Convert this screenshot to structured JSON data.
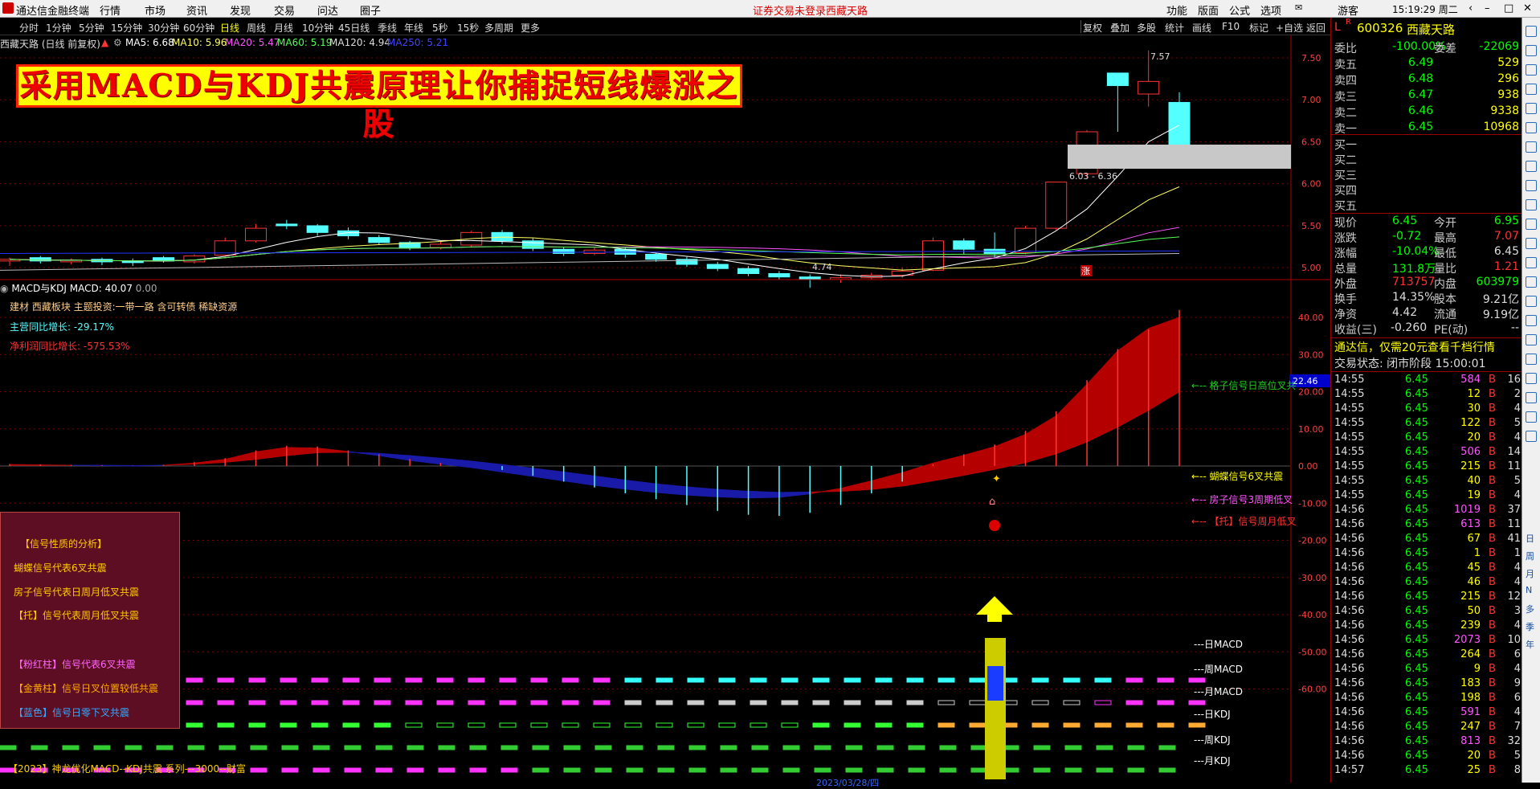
{
  "app": {
    "title": "通达信金融终端",
    "login_notice": "证券交易未登录",
    "stock_name_top": "西藏天路",
    "guest": "游客",
    "clock": "15:19:29 周二"
  },
  "menu": [
    "行情",
    "市场",
    "资讯",
    "发现",
    "交易",
    "问达",
    "圈子"
  ],
  "top_right_menu": [
    "功能",
    "版面",
    "公式",
    "选项"
  ],
  "periods": [
    "分时",
    "1分钟",
    "5分钟",
    "15分钟",
    "30分钟",
    "60分钟",
    "日线",
    "周线",
    "月线",
    "10分钟",
    "45日线",
    "季线",
    "年线",
    "5秒",
    "15秒",
    "多周期",
    "更多"
  ],
  "active_period": "日线",
  "toolbar_right": [
    "复权",
    "叠加",
    "多股",
    "统计",
    "画线",
    "F10",
    "标记",
    "+自选",
    "返回"
  ],
  "chart_info": {
    "name": "西藏天路 (日线 前复权)",
    "ma5": "MA5: 6.68",
    "ma10": "MA10: 5.96",
    "ma20": "MA20: 5.47",
    "ma60": "MA60: 5.19",
    "ma120": "MA120: 4.94",
    "ma250": "MA250: 5.21"
  },
  "banner": "采用MACD与KDJ共震原理让你捕捉短线爆涨之股",
  "price_axis": [
    "7.50",
    "7.00",
    "6.50",
    "6.00",
    "5.50",
    "5.00"
  ],
  "annotations": {
    "high": "7.57",
    "low": "4.74",
    "zone": "6.03 - 6.36",
    "rise": "涨"
  },
  "indicator": {
    "title": "MACD与KDJ",
    "macd": "MACD: 40.07",
    "zero": "0.00",
    "sector": "建材 西藏板块 主题投资:一带一路 含可转债 稀缺资源",
    "rev_growth": "主营同比增长: -29.17%",
    "profit_growth": "净利润同比增长: -575.53%",
    "current_value": "22.46"
  },
  "macd_axis": [
    "40.00",
    "30.00",
    "20.00",
    "10.00",
    "0.00",
    "-10.00",
    "-20.00",
    "-30.00",
    "-40.00",
    "-50.00",
    "-60.00"
  ],
  "signal_labels": [
    "←-- 格子信号日高位叉共",
    "←-- 蝴蝶信号6叉共震",
    "←-- 房子信号3周期低叉",
    "←-- 【托】信号周月低叉"
  ],
  "row_labels": [
    "---日MACD",
    "---周MACD",
    "---月MACD",
    "---日KDJ",
    "---周KDJ",
    "---月KDJ"
  ],
  "legend": {
    "title": "【信号性质的分析】",
    "l1": "蝴蝶信号代表6叉共震",
    "l2": "房子信号代表日周月低叉共震",
    "l3": "【托】信号代表周月低叉共震",
    "l4": "【粉红柱】信号代表6叉共震",
    "l5": "【金黄柱】信号日叉位置较低共震",
    "l6": "【蓝色】信号日零下叉共震"
  },
  "bottom_text": "【2023】神龙优化MACD--KDJ共震 系列---3000--财富",
  "bottom_date": "2023/03/28/四",
  "quote": {
    "code": "600326",
    "name": "西藏天路",
    "weibi": "委比",
    "weibi_val": "-100.00%",
    "weicha": "委差",
    "weicha_val": "-22069",
    "asks": [
      {
        "label": "卖五",
        "price": "6.49",
        "vol": "529"
      },
      {
        "label": "卖四",
        "price": "6.48",
        "vol": "296"
      },
      {
        "label": "卖三",
        "price": "6.47",
        "vol": "938"
      },
      {
        "label": "卖二",
        "price": "6.46",
        "vol": "9338"
      },
      {
        "label": "卖一",
        "price": "6.45",
        "vol": "10968"
      }
    ],
    "bids": [
      "买一",
      "买二",
      "买三",
      "买四",
      "买五"
    ],
    "stats": [
      {
        "a": "现价",
        "av": "6.45",
        "b": "今开",
        "bv": "6.95"
      },
      {
        "a": "涨跌",
        "av": "-0.72",
        "b": "最高",
        "bv": "7.07"
      },
      {
        "a": "涨幅",
        "av": "-10.04%",
        "b": "最低",
        "bv": "6.45"
      },
      {
        "a": "总量",
        "av": "131.8万",
        "b": "量比",
        "bv": "1.21"
      },
      {
        "a": "外盘",
        "av": "713757",
        "b": "内盘",
        "bv": "603979"
      },
      {
        "a": "换手",
        "av": "14.35%",
        "b": "股本",
        "bv": "9.21亿"
      },
      {
        "a": "净资",
        "av": "4.42",
        "b": "流通",
        "bv": "9.19亿"
      },
      {
        "a": "收益(三)",
        "av": "-0.260",
        "b": "PE(动)",
        "bv": "--"
      }
    ],
    "ad": "通达信，仅需20元查看千档行情",
    "trade_state": "交易状态: 闭市阶段 15:00:01"
  },
  "ticks": [
    {
      "t": "14:55",
      "p": "6.45",
      "v": "584",
      "s": "B",
      "n": "16"
    },
    {
      "t": "14:55",
      "p": "6.45",
      "v": "12",
      "s": "B",
      "n": "2"
    },
    {
      "t": "14:55",
      "p": "6.45",
      "v": "30",
      "s": "B",
      "n": "4"
    },
    {
      "t": "14:55",
      "p": "6.45",
      "v": "122",
      "s": "B",
      "n": "5"
    },
    {
      "t": "14:55",
      "p": "6.45",
      "v": "20",
      "s": "B",
      "n": "4"
    },
    {
      "t": "14:55",
      "p": "6.45",
      "v": "506",
      "s": "B",
      "n": "14"
    },
    {
      "t": "14:55",
      "p": "6.45",
      "v": "215",
      "s": "B",
      "n": "11"
    },
    {
      "t": "14:55",
      "p": "6.45",
      "v": "40",
      "s": "B",
      "n": "5"
    },
    {
      "t": "14:55",
      "p": "6.45",
      "v": "19",
      "s": "B",
      "n": "4"
    },
    {
      "t": "14:56",
      "p": "6.45",
      "v": "1019",
      "s": "B",
      "n": "37"
    },
    {
      "t": "14:56",
      "p": "6.45",
      "v": "613",
      "s": "B",
      "n": "11"
    },
    {
      "t": "14:56",
      "p": "6.45",
      "v": "67",
      "s": "B",
      "n": "41"
    },
    {
      "t": "14:56",
      "p": "6.45",
      "v": "1",
      "s": "B",
      "n": "1"
    },
    {
      "t": "14:56",
      "p": "6.45",
      "v": "45",
      "s": "B",
      "n": "4"
    },
    {
      "t": "14:56",
      "p": "6.45",
      "v": "46",
      "s": "B",
      "n": "4"
    },
    {
      "t": "14:56",
      "p": "6.45",
      "v": "215",
      "s": "B",
      "n": "12"
    },
    {
      "t": "14:56",
      "p": "6.45",
      "v": "50",
      "s": "B",
      "n": "3"
    },
    {
      "t": "14:56",
      "p": "6.45",
      "v": "239",
      "s": "B",
      "n": "4"
    },
    {
      "t": "14:56",
      "p": "6.45",
      "v": "2073",
      "s": "B",
      "n": "10"
    },
    {
      "t": "14:56",
      "p": "6.45",
      "v": "264",
      "s": "B",
      "n": "6"
    },
    {
      "t": "14:56",
      "p": "6.45",
      "v": "9",
      "s": "B",
      "n": "4"
    },
    {
      "t": "14:56",
      "p": "6.45",
      "v": "183",
      "s": "B",
      "n": "9"
    },
    {
      "t": "14:56",
      "p": "6.45",
      "v": "198",
      "s": "B",
      "n": "6"
    },
    {
      "t": "14:56",
      "p": "6.45",
      "v": "591",
      "s": "B",
      "n": "4"
    },
    {
      "t": "14:56",
      "p": "6.45",
      "v": "247",
      "s": "B",
      "n": "7"
    },
    {
      "t": "14:56",
      "p": "6.45",
      "v": "813",
      "s": "B",
      "n": "32"
    },
    {
      "t": "14:56",
      "p": "6.45",
      "v": "20",
      "s": "B",
      "n": "5"
    },
    {
      "t": "14:57",
      "p": "6.45",
      "v": "25",
      "s": "B",
      "n": "8"
    }
  ],
  "side_tools": [
    "日",
    "周",
    "月",
    "N",
    "多",
    "季",
    "年"
  ],
  "candles": [
    {
      "o": 5.06,
      "c": 5.08,
      "h": 5.1,
      "l": 5.0
    },
    {
      "o": 5.1,
      "c": 5.06,
      "h": 5.12,
      "l": 5.03
    },
    {
      "o": 5.05,
      "c": 5.07,
      "h": 5.09,
      "l": 5.02
    },
    {
      "o": 5.08,
      "c": 5.05,
      "h": 5.1,
      "l": 5.01
    },
    {
      "o": 5.06,
      "c": 5.05,
      "h": 5.09,
      "l": 5.0
    },
    {
      "o": 5.1,
      "c": 5.06,
      "h": 5.12,
      "l": 5.04
    },
    {
      "o": 5.05,
      "c": 5.12,
      "h": 5.14,
      "l": 5.03
    },
    {
      "o": 5.13,
      "c": 5.3,
      "h": 5.34,
      "l": 5.12
    },
    {
      "o": 5.3,
      "c": 5.45,
      "h": 5.5,
      "l": 5.28
    },
    {
      "o": 5.5,
      "c": 5.48,
      "h": 5.55,
      "l": 5.44
    },
    {
      "o": 5.48,
      "c": 5.4,
      "h": 5.5,
      "l": 5.36
    },
    {
      "o": 5.42,
      "c": 5.36,
      "h": 5.46,
      "l": 5.32
    },
    {
      "o": 5.34,
      "c": 5.28,
      "h": 5.37,
      "l": 5.25
    },
    {
      "o": 5.28,
      "c": 5.22,
      "h": 5.3,
      "l": 5.19
    },
    {
      "o": 5.22,
      "c": 5.26,
      "h": 5.3,
      "l": 5.2
    },
    {
      "o": 5.25,
      "c": 5.4,
      "h": 5.42,
      "l": 5.22
    },
    {
      "o": 5.4,
      "c": 5.3,
      "h": 5.43,
      "l": 5.26
    },
    {
      "o": 5.3,
      "c": 5.21,
      "h": 5.33,
      "l": 5.18
    },
    {
      "o": 5.2,
      "c": 5.15,
      "h": 5.23,
      "l": 5.12
    },
    {
      "o": 5.15,
      "c": 5.19,
      "h": 5.22,
      "l": 5.13
    },
    {
      "o": 5.2,
      "c": 5.14,
      "h": 5.22,
      "l": 5.1
    },
    {
      "o": 5.14,
      "c": 5.08,
      "h": 5.16,
      "l": 5.05
    },
    {
      "o": 5.08,
      "c": 5.02,
      "h": 5.11,
      "l": 4.99
    },
    {
      "o": 5.02,
      "c": 4.97,
      "h": 5.05,
      "l": 4.94
    },
    {
      "o": 4.97,
      "c": 4.91,
      "h": 5.0,
      "l": 4.88
    },
    {
      "o": 4.91,
      "c": 4.87,
      "h": 4.94,
      "l": 4.84
    },
    {
      "o": 4.87,
      "c": 4.84,
      "h": 4.9,
      "l": 4.74
    },
    {
      "o": 4.84,
      "c": 4.86,
      "h": 4.9,
      "l": 4.8
    },
    {
      "o": 4.86,
      "c": 4.89,
      "h": 4.92,
      "l": 4.84
    },
    {
      "o": 4.89,
      "c": 4.94,
      "h": 4.98,
      "l": 4.86
    },
    {
      "o": 4.95,
      "c": 5.3,
      "h": 5.34,
      "l": 4.94
    },
    {
      "o": 5.3,
      "c": 5.2,
      "h": 5.33,
      "l": 5.14
    },
    {
      "o": 5.2,
      "c": 5.15,
      "h": 5.4,
      "l": 5.1
    },
    {
      "o": 5.16,
      "c": 5.45,
      "h": 5.48,
      "l": 5.14
    },
    {
      "o": 5.45,
      "c": 6.0,
      "h": 6.0,
      "l": 5.43
    },
    {
      "o": 6.1,
      "c": 6.6,
      "h": 6.62,
      "l": 6.05
    },
    {
      "o": 7.3,
      "c": 7.15,
      "h": 7.3,
      "l": 6.6
    },
    {
      "o": 7.05,
      "c": 7.2,
      "h": 7.57,
      "l": 6.9
    },
    {
      "o": 6.95,
      "c": 6.45,
      "h": 7.07,
      "l": 6.45
    }
  ],
  "macd_hist": [
    0.5,
    0.4,
    0.3,
    0.2,
    0.1,
    0.3,
    1.0,
    2.0,
    4.0,
    5.2,
    5.0,
    4.0,
    3.0,
    1.8,
    0.8,
    0.0,
    -1.0,
    -2.5,
    -4.0,
    -5.5,
    -7.0,
    -8.5,
    -10.0,
    -11.5,
    -12.5,
    -12.8,
    -12.0,
    -10.0,
    -7.0,
    -4.0,
    0.5,
    3.0,
    5.5,
    9.0,
    14.0,
    22.0,
    30.0,
    35.0,
    40.0
  ],
  "macd_dif": [
    0.4,
    0.3,
    0.2,
    0.1,
    0.0,
    0.2,
    0.8,
    1.8,
    3.8,
    5.0,
    4.8,
    3.9,
    2.8,
    1.5,
    0.5,
    -0.4,
    -1.6,
    -2.8,
    -4.0,
    -5.2,
    -6.2,
    -7.1,
    -7.8,
    -8.3,
    -8.6,
    -8.4,
    -7.5,
    -6.0,
    -4.0,
    -1.8,
    0.8,
    2.9,
    5.2,
    8.5,
    13.5,
    22.0,
    31.0,
    37.0,
    40.0
  ],
  "macd_dea": [
    0.2,
    0.2,
    0.2,
    0.2,
    0.1,
    0.2,
    0.5,
    1.0,
    1.8,
    2.8,
    3.6,
    3.7,
    3.4,
    2.8,
    2.1,
    1.3,
    0.4,
    -0.6,
    -1.6,
    -2.7,
    -3.8,
    -4.8,
    -5.6,
    -6.3,
    -6.8,
    -7.1,
    -7.0,
    -6.8,
    -6.3,
    -5.4,
    -4.0,
    -2.5,
    -0.9,
    0.9,
    3.3,
    6.5,
    10.5,
    15.0,
    20.0
  ],
  "colors": {
    "up": "#ff3333",
    "down": "#54ffff",
    "grid": "#7a0000",
    "axis": "#ff4040"
  }
}
